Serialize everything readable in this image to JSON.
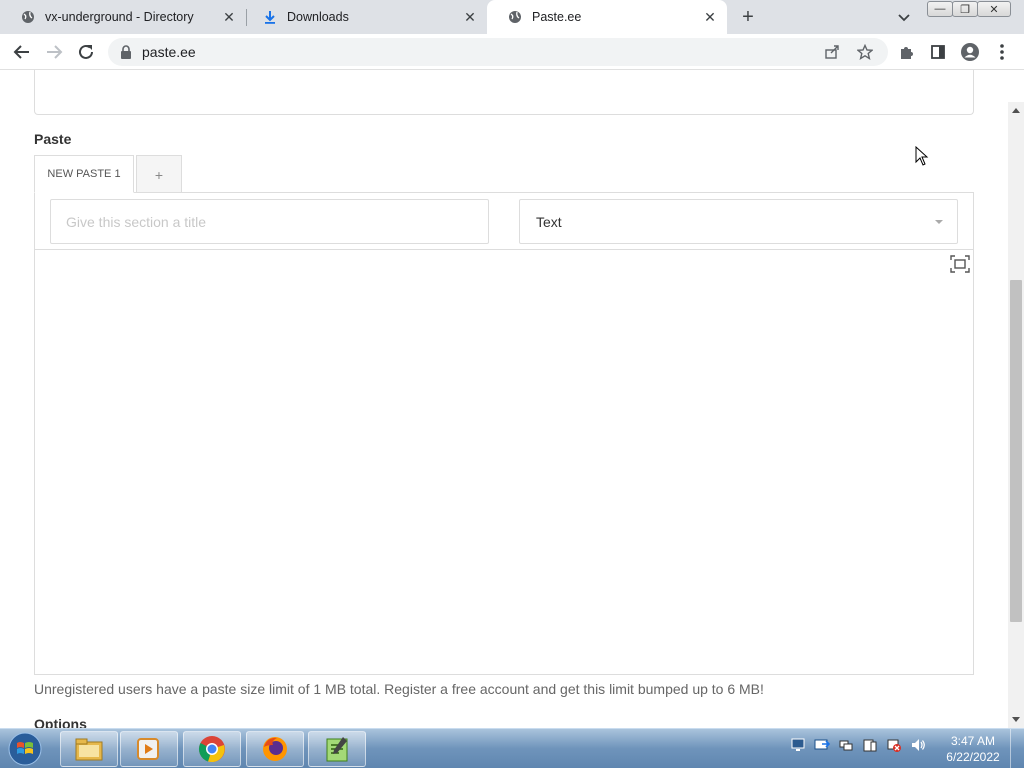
{
  "browser": {
    "tabs": [
      {
        "title": "vx-underground - Directory",
        "icon": "globe-icon",
        "active": false
      },
      {
        "title": "Downloads",
        "icon": "download-icon",
        "active": false
      },
      {
        "title": "Paste.ee",
        "icon": "globe-icon",
        "active": true
      }
    ],
    "address": "paste.ee"
  },
  "page": {
    "section_label": "Paste",
    "tabs": [
      {
        "label": "NEW PASTE 1",
        "active": true
      },
      {
        "label": "+",
        "active": false
      }
    ],
    "section_title": {
      "placeholder": "Give this section a title",
      "value": ""
    },
    "language": {
      "selected": "Text"
    },
    "limit_note": "Unregistered users have a paste size limit of 1 MB total. Register a free account and get this limit bumped up to 6 MB!",
    "options_label": "Options"
  },
  "taskbar": {
    "apps": [
      "file-explorer-icon",
      "media-player-icon",
      "chrome-icon",
      "firefox-icon",
      "notepad-plus-icon"
    ],
    "clock": {
      "time": "3:47 AM",
      "date": "6/22/2022"
    }
  },
  "colors": {
    "accent": "#1a73e8",
    "taskbar": "#6f94bb"
  }
}
